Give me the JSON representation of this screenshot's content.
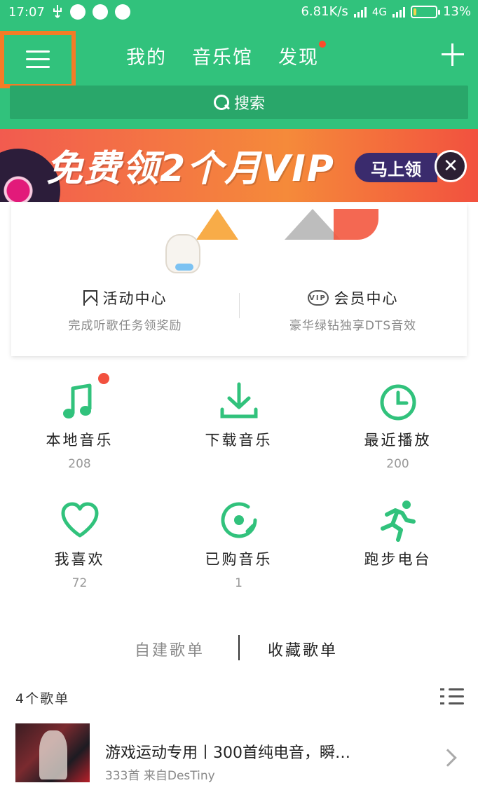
{
  "status_bar": {
    "time": "17:07",
    "network_speed": "6.81K/s",
    "network_type": "4G",
    "battery": "13%",
    "battery_level": 0.13
  },
  "header": {
    "tabs": [
      {
        "label": "我的",
        "has_dot": false
      },
      {
        "label": "音乐馆",
        "has_dot": false
      },
      {
        "label": "发现",
        "has_dot": true
      }
    ],
    "search_label": "搜索",
    "accent_color": "#31c27c",
    "highlight_color": "#f47c26"
  },
  "banner": {
    "text": "免费领2个月VIP",
    "cta": "马上领",
    "close": "✕"
  },
  "card": {
    "activity": {
      "title": "活动中心",
      "subtitle": "完成听歌任务领奖励"
    },
    "vip": {
      "title": "会员中心",
      "subtitle": "豪华绿钻独享DTS音效",
      "badge": "VIP"
    }
  },
  "features": [
    {
      "label": "本地音乐",
      "count": "208",
      "icon": "music-note-icon",
      "badge": true
    },
    {
      "label": "下载音乐",
      "count": "",
      "icon": "download-icon",
      "badge": false
    },
    {
      "label": "最近播放",
      "count": "200",
      "icon": "clock-icon",
      "badge": false
    },
    {
      "label": "我喜欢",
      "count": "72",
      "icon": "heart-icon",
      "badge": false
    },
    {
      "label": "已购音乐",
      "count": "1",
      "icon": "disc-icon",
      "badge": false
    },
    {
      "label": "跑步电台",
      "count": "",
      "icon": "runner-icon",
      "badge": false
    }
  ],
  "playlist_tabs": {
    "self_created": "自建歌单",
    "collected": "收藏歌单",
    "active": "collected"
  },
  "playlists": {
    "count_label": "4个歌单",
    "items": [
      {
        "title": "游戏运动专用丨300首纯电音，瞬…",
        "meta": "333首 来自DesTiny"
      }
    ]
  }
}
